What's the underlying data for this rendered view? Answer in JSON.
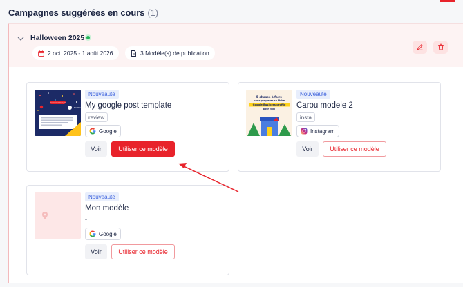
{
  "section": {
    "title": "Campagnes suggérées en cours",
    "count": "(1)"
  },
  "campaign": {
    "name": "Halloween 2025",
    "status_color": "#24b35a",
    "date_range": "2 oct. 2025 - 1 août 2026",
    "templates_count": "3 Modèle(s) de publication",
    "actions": {
      "edit_icon": "pencil-icon",
      "delete_icon": "trash-icon"
    }
  },
  "cards": [
    {
      "badge": "Nouveauté",
      "title": "My google post template",
      "tag": "review",
      "network": "Google",
      "view_label": "Voir",
      "use_label": "Utiliser ce modèle",
      "thumb_text": {
        "a": "Recherche Google",
        "b": "TimeBall"
      }
    },
    {
      "badge": "Nouveauté",
      "title": "Carou modele 2",
      "tag": "insta",
      "network": "Instagram",
      "view_label": "Voir",
      "use_label": "Utiliser ce modèle",
      "thumb_text": {
        "l1": "5 choses à faire",
        "l2": "pour préparer sa fiche",
        "l3": "Google Business profile",
        "l4": "pour Noël"
      }
    },
    {
      "badge": "Nouveauté",
      "title": "Mon modèle",
      "tag": "-",
      "network": "Google",
      "view_label": "Voir",
      "use_label": "Utiliser ce modèle"
    }
  ],
  "colors": {
    "accent": "#e8232b",
    "badge_bg": "#e8eefc",
    "badge_text": "#3e63dd"
  }
}
